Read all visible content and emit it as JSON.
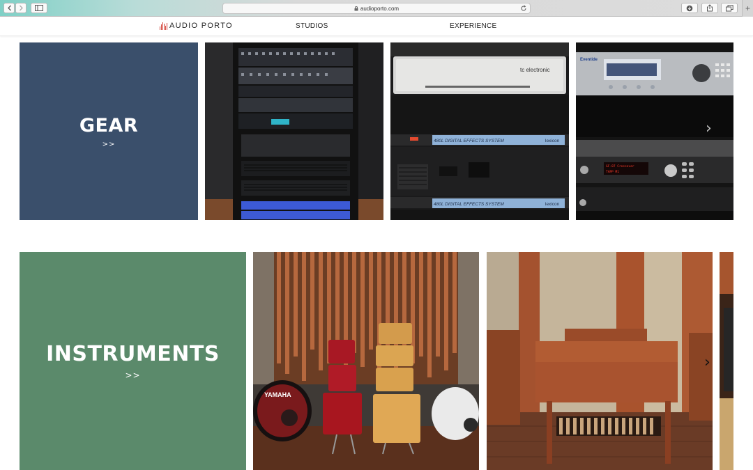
{
  "browser": {
    "url": "audioporto.com"
  },
  "nav": {
    "logo_text": "AUDIO PORTO",
    "links": [
      "STUDIOS",
      "EXPERIENCE"
    ]
  },
  "sections": {
    "gear": {
      "title": "GEAR",
      "arrows": ">>",
      "color": "#3a4f6b",
      "photo_labels": {
        "tc_brand": "tc electronic",
        "lexicon_model_1": "480L  DIGITAL EFFECTS SYSTEM",
        "lexicon_brand_1": "lexicon",
        "lexicon_model_2": "480L  DIGITAL EFFECTS SYSTEM",
        "lexicon_brand_2": "lexicon",
        "eventide_brand": "Eventide",
        "display_line_1": "GF-87 Crossover",
        "display_line_2": "TAPP M1"
      }
    },
    "instruments": {
      "title": "INSTRUMENTS",
      "arrows": ">>",
      "color": "#5b8a6b",
      "photo_labels": {
        "drum_brand": "YAMAHA"
      }
    }
  },
  "carousel": {
    "next_glyph": "›"
  }
}
